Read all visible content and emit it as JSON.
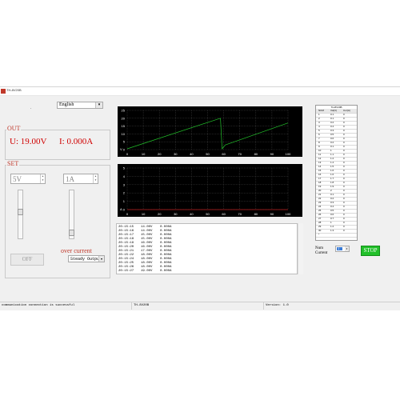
{
  "window": {
    "title": "TH-8V20B"
  },
  "language": {
    "dot": ".",
    "value": "English"
  },
  "out": {
    "title": "OUT",
    "voltage_label": "U:",
    "voltage": "19.00V",
    "current_label": "I:",
    "current": "0.000A"
  },
  "set": {
    "title": "SET",
    "voltage_value": "5V",
    "current_value": "1A",
    "off_label": "OFF",
    "over_current_label": "over current",
    "mode_value": "Steady Output",
    "voltage_slider_level": 0.55,
    "current_slider_level": 0.05
  },
  "chart_voltage": {
    "type": "line",
    "yticks": [
      "25",
      "20",
      "15",
      "10",
      "5",
      "0"
    ],
    "ylabel": "V",
    "xticks": [
      "0",
      "10",
      "20",
      "30",
      "40",
      "50",
      "60",
      "70",
      "80",
      "90",
      "100"
    ],
    "ylim": [
      0,
      25
    ],
    "xlim": [
      0,
      100
    ],
    "line_color": "#22c02a",
    "series": [
      {
        "x": [
          0,
          58,
          59,
          61,
          100
        ],
        "y": [
          0.5,
          20,
          0.5,
          3,
          17
        ]
      }
    ]
  },
  "chart_current": {
    "type": "line",
    "yticks": [
      "5",
      "4",
      "3",
      "2",
      "1",
      "0"
    ],
    "ylabel": "A",
    "xticks": [
      "0",
      "10",
      "20",
      "30",
      "40",
      "50",
      "60",
      "70",
      "80",
      "90",
      "100"
    ],
    "ylim": [
      0,
      5
    ],
    "xlim": [
      0,
      100
    ],
    "line_color": "#c02020",
    "series": [
      {
        "x": [
          0,
          100
        ],
        "y": [
          0,
          0
        ]
      }
    ]
  },
  "log": {
    "rows": [
      {
        "time": "20:15:15",
        "voltage": "14.00V",
        "current": "0.000A"
      },
      {
        "time": "20:15:16",
        "voltage": "14.00V",
        "current": "0.000A"
      },
      {
        "time": "20:15:17",
        "voltage": "15.00V",
        "current": "0.000A"
      },
      {
        "time": "20:15:18",
        "voltage": "15.00V",
        "current": "0.000A"
      },
      {
        "time": "20:15:19",
        "voltage": "16.00V",
        "current": "0.000A"
      },
      {
        "time": "20:15:20",
        "voltage": "16.00V",
        "current": "0.000A"
      },
      {
        "time": "20:15:21",
        "voltage": "17.00V",
        "current": "0.000A"
      },
      {
        "time": "20:15:22",
        "voltage": "18.00V",
        "current": "0.000A"
      },
      {
        "time": "20:15:24",
        "voltage": "18.00V",
        "current": "0.000A"
      },
      {
        "time": "20:15:25",
        "voltage": "18.00V",
        "current": "0.000A"
      },
      {
        "time": "20:15:26",
        "voltage": "18.00V",
        "current": "0.000A"
      },
      {
        "time": "20:15:27",
        "voltage": "19.00V",
        "current": "0.000A"
      }
    ]
  },
  "table": {
    "title": "TH-8V20B",
    "headers": [
      "NUM",
      "Vol(V)",
      "Cur(A)"
    ],
    "rows": [
      [
        "1",
        "0.1",
        "0"
      ],
      [
        "2",
        "0.1",
        "0"
      ],
      [
        "3",
        "0.2",
        "0"
      ],
      [
        "4",
        "0.4",
        "0"
      ],
      [
        "5",
        "0.3",
        "0"
      ],
      [
        "6",
        "0.5",
        "0"
      ],
      [
        "7",
        "0.6",
        "0"
      ],
      [
        "8",
        "0.2",
        "0"
      ],
      [
        "9",
        "0.1",
        "0"
      ],
      [
        "10",
        "1",
        "0"
      ],
      [
        "11",
        "1.1",
        "0"
      ],
      [
        "12",
        "1.2",
        "0"
      ],
      [
        "13",
        "1.4",
        "0"
      ],
      [
        "14",
        "1.5",
        "0"
      ],
      [
        "15",
        "1.6",
        "0"
      ],
      [
        "16",
        "1.6",
        "0"
      ],
      [
        "17",
        "1.7",
        "0"
      ],
      [
        "18",
        "1.8",
        "0"
      ],
      [
        "19",
        "1.9",
        "0"
      ],
      [
        "20",
        "2",
        "0"
      ],
      [
        "21",
        "0.1",
        "0"
      ],
      [
        "22",
        "0.2",
        "0"
      ],
      [
        "23",
        "0.3",
        "0"
      ],
      [
        "24",
        "0.4",
        "0"
      ],
      [
        "25",
        "0.5",
        "0"
      ],
      [
        "26",
        "0.6",
        "0"
      ],
      [
        "27",
        "0.7",
        "0"
      ],
      [
        "28",
        "1",
        "0"
      ],
      [
        "29",
        "1.2",
        "0"
      ],
      [
        "30",
        "1.3",
        "0"
      ],
      [
        "*",
        "",
        ""
      ]
    ]
  },
  "controls": {
    "num_label": "Num",
    "cur_label": "Current",
    "num_value": "1",
    "stop_label": "STOP"
  },
  "status": {
    "message": "communication connection is successful",
    "model": "TH-8V20B",
    "version": "Version: 1.0"
  }
}
